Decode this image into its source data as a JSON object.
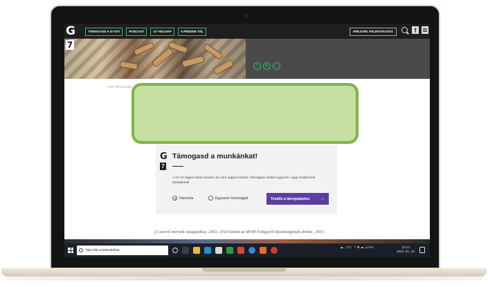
{
  "nav": {
    "logo_g": "G",
    "logo_7": "7",
    "items": [
      "TÁMOGASD A G7-ET!",
      "PODCAST",
      "G7 HOLNAP",
      "A PÉNZEM TÖL"
    ],
    "newsletter": "HÍRLEVÉL FELIRATKOZÁS",
    "fb": "f"
  },
  "hero": {
    "share_icons": [
      "facebook-share-icon",
      "email-share-icon",
      "more-share-icon"
    ],
    "credit": "Fotó: MTI/ Kovács"
  },
  "support": {
    "logo_g": "G",
    "logo_7": "7",
    "title": "Támogasd a munkánkat!",
    "description": "A G7-et ingyen lehet olvasni, de nem ingyen készül. Támogass minket egyszeri, vagy rendszeres átutalással!",
    "options": [
      "Havonta",
      "Egyszeri összeggel"
    ],
    "selected": "Havonta",
    "cta": "Tovább a támogatáshoz",
    "cta_arrow": "→"
  },
  "article": {
    "text": "(A szerző mérnök–közgazdász, 2002–2010 között az MVM Felügyelő Bizottságának elnöke, 2015–"
  },
  "taskbar": {
    "search_placeholder": "Írjon ide a kereséshez",
    "weather": "1°C",
    "tray": "^ ⊕ ☁ ⊿ HU",
    "time": "22:12",
    "date": "2022. 01. 25."
  },
  "colors": {
    "accent_green": "#2fbf6e",
    "cta_purple": "#5b3fa0",
    "overlay_fill": "#c6dea0",
    "overlay_border": "#7db446"
  }
}
